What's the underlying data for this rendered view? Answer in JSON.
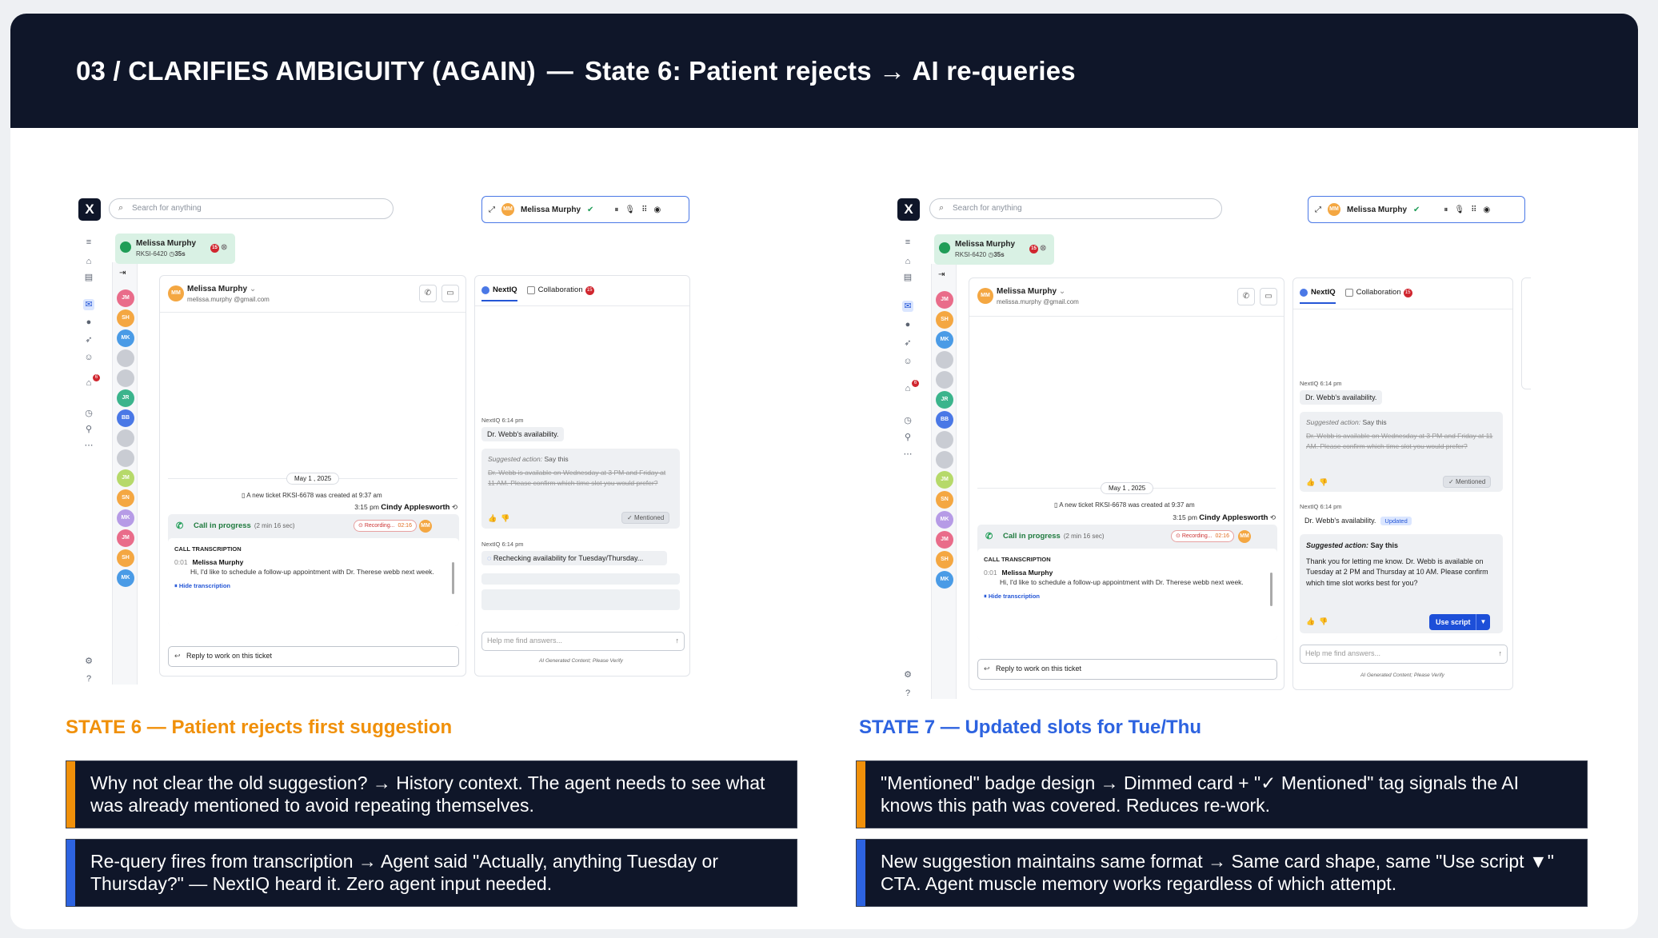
{
  "header": {
    "section": "03 / CLARIFIES AMBIGUITY (AGAIN)",
    "separator": "—",
    "subtitle": "State 6: Patient rejects → AI re-queries"
  },
  "app": {
    "logo": "X",
    "search_placeholder": "Search for anything",
    "active_call_name": "Melissa Murphy",
    "ticket_tab_name": "Melissa Murphy",
    "ticket_tab_id": "RKSI-6420",
    "ticket_tab_timer": "35s",
    "ticket_tab_badge": "15",
    "contact_name": "Melissa Murphy",
    "contact_email": "melissa.murphy @gmail.com",
    "date_pill": "May 1 , 2025",
    "system_message": "A new ticket RKSI-6678 was created at 9:37 am",
    "agent_time": "3:15 pm",
    "agent_name": "Cindy Applesworth",
    "call_status": "Call in progress",
    "call_duration": "(2 min 16 sec)",
    "recording_label": "Recording...",
    "recording_time": "02:16",
    "transcription_heading": "CALL TRANSCRIPTION",
    "transcription_time": "0:01",
    "transcription_speaker": "Melissa Murphy",
    "transcription_text": "Hi, I'd like to schedule a follow-up appointment with Dr. Therese webb next week.",
    "hide_transcription": "Hide transcription",
    "reply_label": "Reply to work on this ticket",
    "rail_avatars": [
      "JM",
      "SH",
      "MK",
      "",
      "",
      "JR",
      "BB",
      "",
      "",
      "JM",
      "SN",
      "MK",
      "JM",
      "SH",
      "MK"
    ],
    "rail_colors": [
      "#e96c8a",
      "#f4a742",
      "#4a9be6",
      "#c9ccd3",
      "#c9ccd3",
      "#3bb48c",
      "#4a78e6",
      "#c9ccd3",
      "#c9ccd3",
      "#b6d96a",
      "#f4a742",
      "#b69be6",
      "#e96c8a",
      "#f4a742",
      "#4a9be6"
    ],
    "sidebar_badge": "6"
  },
  "nextiq": {
    "tab_nextiq": "NextIQ",
    "tab_collaboration": "Collaboration",
    "collab_badge": "15",
    "sender": "NextIQ",
    "time": "6:14 pm",
    "query_1": "Dr. Webb's availability.",
    "suggested_prefix": "Suggested action:",
    "suggested_say": "Say this",
    "old_suggestion": "Dr. Webb is available on Wednesday at 3 PM and Friday at 11 AM. Please confirm which time slot you would prefer?",
    "mentioned_label": "Mentioned",
    "requery_text": "Rechecking availability for Tuesday/Thursday...",
    "updated_tag": "Updated",
    "new_suggestion": "Thank you for letting me know. Dr. Webb is available on Tuesday at 2 PM and Thursday at 10 AM. Please confirm which time slot works best for you?",
    "use_script": "Use script",
    "ask_placeholder": "Help me find answers...",
    "disclaimer": "AI Generated Content; Please Verify"
  },
  "states": {
    "s6_title": "STATE 6 — Patient rejects first suggestion",
    "s7_title": "STATE 7 — Updated slots for Tue/Thu",
    "s6_note1": "Why not clear the old suggestion? → History context. The agent needs to see what was already mentioned to avoid repeating themselves.",
    "s6_note2": "Re-query fires from transcription → Agent said \"Actually, anything Tuesday or Thursday?\" — NextIQ heard it. Zero agent input needed.",
    "s7_note1": "\"Mentioned\" badge design → Dimmed card + \"✓ Mentioned\" tag signals the AI knows this path was covered. Reduces re-work.",
    "s7_note2": "New suggestion maintains same format → Same card shape, same \"Use script ▼\" CTA. Agent muscle memory works regardless of which attempt."
  },
  "colors": {
    "state6_accent": "#f0900a",
    "state7_accent": "#2d63e0",
    "banner_bg": "#0f1629"
  }
}
